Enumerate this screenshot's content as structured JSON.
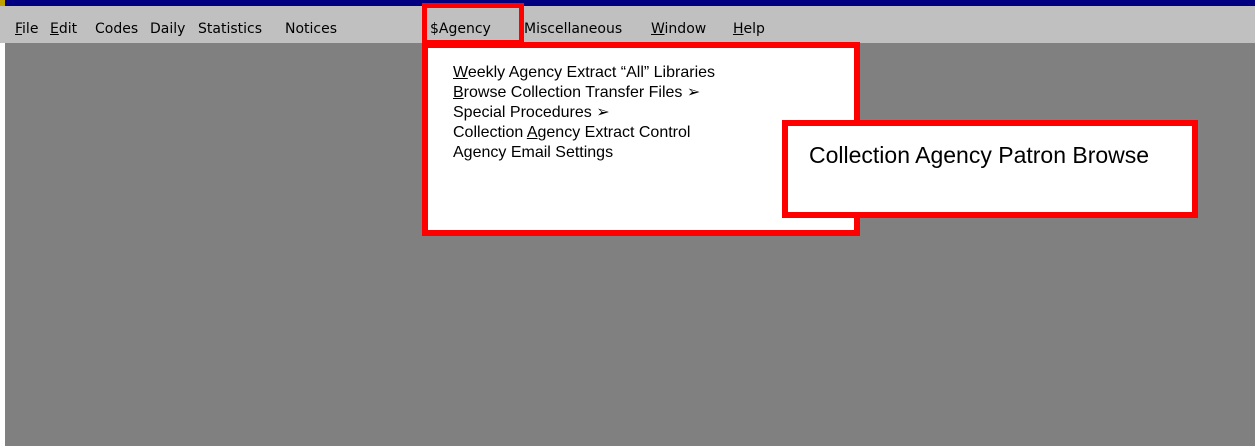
{
  "menubar": {
    "items": [
      {
        "label_pre": "",
        "label_ul": "F",
        "label_post": "ile"
      },
      {
        "label_pre": "",
        "label_ul": "E",
        "label_post": "dit"
      },
      {
        "label_pre": "Codes",
        "label_ul": "",
        "label_post": ""
      },
      {
        "label_pre": "Daily",
        "label_ul": "",
        "label_post": ""
      },
      {
        "label_pre": "Statistics",
        "label_ul": "",
        "label_post": ""
      },
      {
        "label_pre": "Notices",
        "label_ul": "",
        "label_post": ""
      },
      {
        "label_pre": "$Agency",
        "label_ul": "",
        "label_post": ""
      },
      {
        "label_pre": "Miscellaneous",
        "label_ul": "",
        "label_post": ""
      },
      {
        "label_pre": "",
        "label_ul": "W",
        "label_post": "indow"
      },
      {
        "label_pre": "",
        "label_ul": "H",
        "label_post": "elp"
      }
    ]
  },
  "dropdown": {
    "items": [
      {
        "pre": "",
        "ul": "W",
        "post": "eekly Agency Extract “All” Libraries"
      },
      {
        "pre": "",
        "ul": "B",
        "post": "rowse Collection Transfer Files ➢"
      },
      {
        "pre": "Special Procedures ➢",
        "ul": "",
        "post": ""
      },
      {
        "pre": "Collection ",
        "ul": "A",
        "post": "gency Extract Control"
      },
      {
        "pre": "Agency Email Settings",
        "ul": "",
        "post": ""
      }
    ]
  },
  "callout": {
    "text": "Collection Agency Patron Browse"
  },
  "colors": {
    "highlight": "#ff0000",
    "menubar": "#c0c0c0",
    "workspace": "#808080",
    "titlebar": "#000080"
  }
}
